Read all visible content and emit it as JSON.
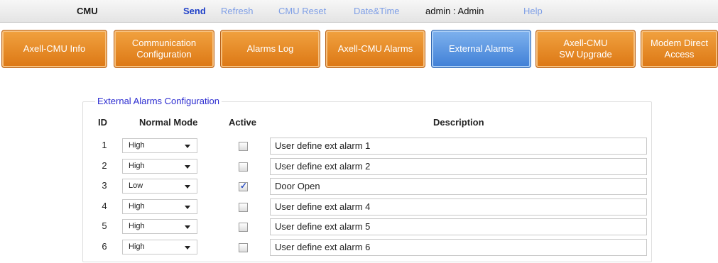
{
  "topbar": {
    "brand": "CMU",
    "send": "Send",
    "refresh": "Refresh",
    "cmu_reset": "CMU Reset",
    "date_time": "Date&Time",
    "user": "admin : Admin",
    "help": "Help"
  },
  "tabs": [
    {
      "line1": "Axell-CMU Info",
      "line2": ""
    },
    {
      "line1": "Communication",
      "line2": "Configuration"
    },
    {
      "line1": "Alarms Log",
      "line2": ""
    },
    {
      "line1": "Axell-CMU Alarms",
      "line2": ""
    },
    {
      "line1": "External Alarms",
      "line2": ""
    },
    {
      "line1": "Axell-CMU",
      "line2": "SW Upgrade"
    },
    {
      "line1": "Modem Direct",
      "line2": "Access"
    }
  ],
  "active_tab": "External Alarms",
  "panel": {
    "legend": "External Alarms Configuration",
    "headers": {
      "id": "ID",
      "mode": "Normal Mode",
      "active": "Active",
      "description": "Description"
    },
    "rows": [
      {
        "id": "1",
        "mode": "High",
        "active": false,
        "description": "User define ext alarm 1"
      },
      {
        "id": "2",
        "mode": "High",
        "active": false,
        "description": "User define ext alarm 2"
      },
      {
        "id": "3",
        "mode": "Low",
        "active": true,
        "description": "Door Open"
      },
      {
        "id": "4",
        "mode": "High",
        "active": false,
        "description": "User define ext alarm 4"
      },
      {
        "id": "5",
        "mode": "High",
        "active": false,
        "description": "User define ext alarm 5"
      },
      {
        "id": "6",
        "mode": "High",
        "active": false,
        "description": "User define ext alarm 6"
      }
    ]
  },
  "icons": {
    "dropdown": "chevron-down-icon",
    "check": "checkmark-icon"
  },
  "colors": {
    "tab_orange": "#e88a2a",
    "tab_blue": "#5a93e0",
    "link_blue": "#1f40c8"
  }
}
